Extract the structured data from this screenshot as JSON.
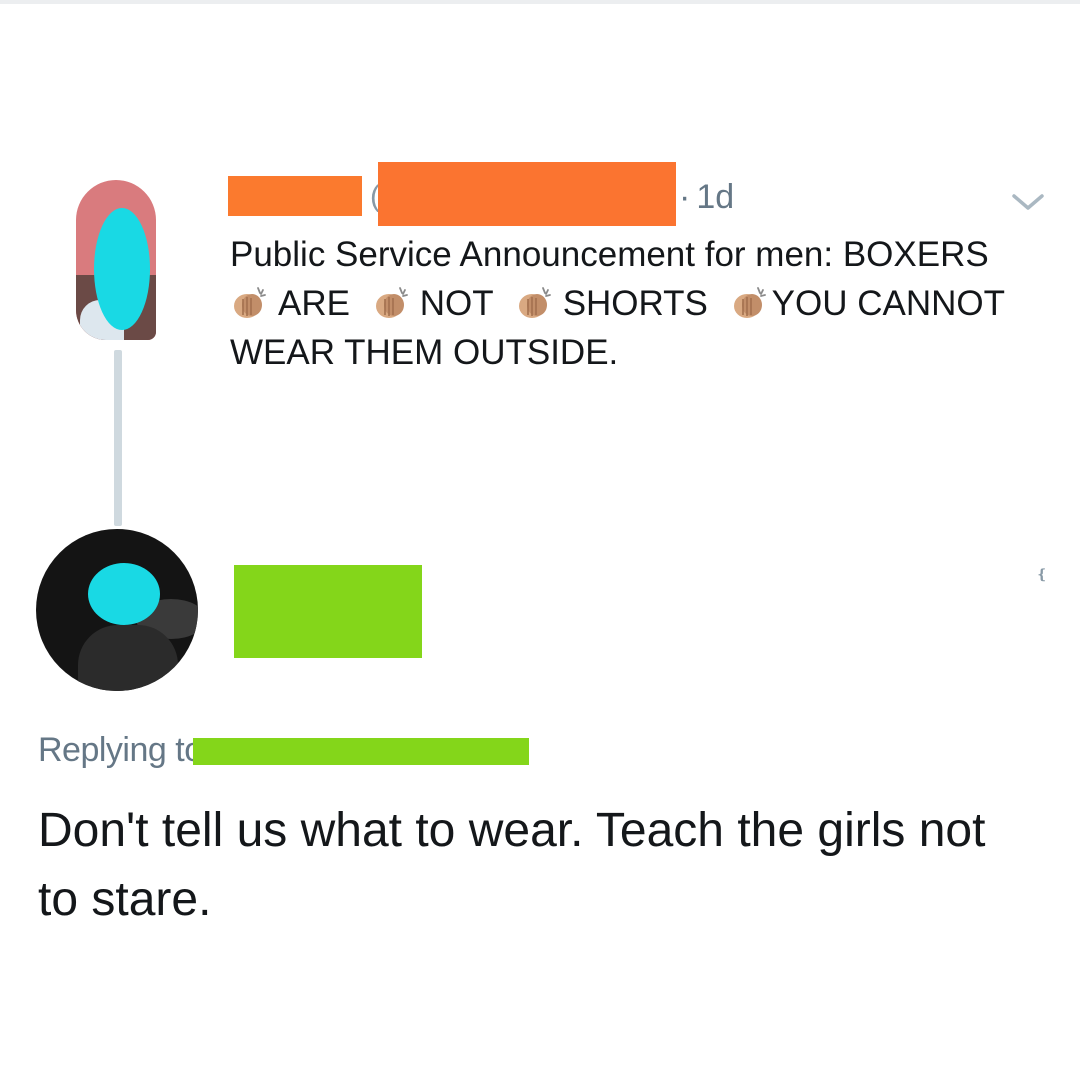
{
  "tweet1": {
    "timestamp": "1d",
    "dot": "·",
    "line1": "Public Service Announcement for men: BOXERS",
    "words": [
      "ARE",
      "NOT",
      "SHORTS",
      "YOU CANNOT"
    ],
    "line3": "WEAR THEM OUTSIDE.",
    "handle_paren": "(",
    "clap_icon": "clapping-hands-icon"
  },
  "tweet2": {
    "replying_label": "Replying to",
    "text": "Don't tell us what to wear. Teach the girls not to stare."
  },
  "colors": {
    "redact_orange": "#fb7a2e",
    "redact_green": "#84d61a",
    "blur_cyan": "#19d9e4",
    "muted_text": "#657786"
  }
}
